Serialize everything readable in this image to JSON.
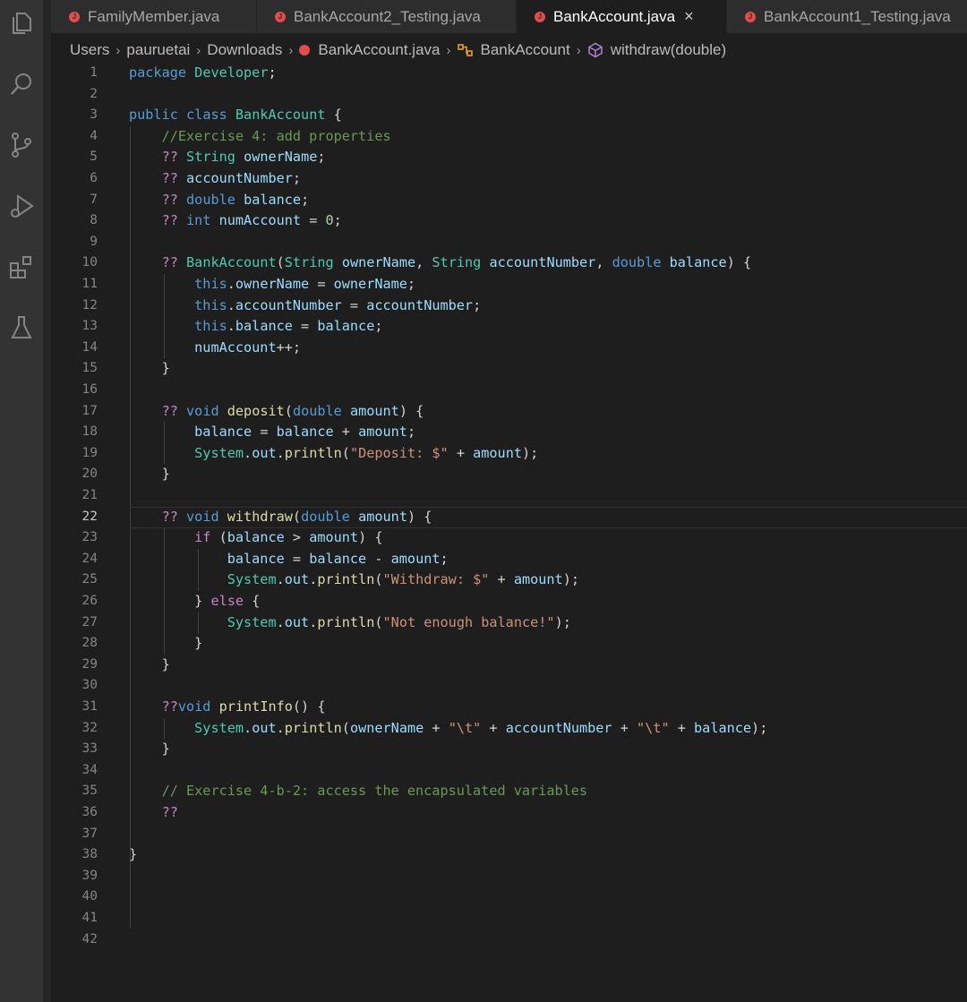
{
  "tabs": [
    {
      "label": "FamilyMember.java",
      "active": false
    },
    {
      "label": "BankAccount2_Testing.java",
      "active": false
    },
    {
      "label": "BankAccount.java",
      "active": true
    },
    {
      "label": "BankAccount1_Testing.java",
      "active": false
    }
  ],
  "tab_close_glyph": "×",
  "breadcrumb": {
    "items": [
      "Users",
      "pauruetai",
      "Downloads",
      "BankAccount.java",
      "BankAccount",
      "withdraw(double)"
    ],
    "separator": "›"
  },
  "activity_icons": [
    "explorer-icon",
    "search-icon",
    "source-control-icon",
    "run-debug-icon",
    "extensions-icon",
    "testing-icon"
  ],
  "editor": {
    "current_line": 22,
    "line_numbers": [
      "1",
      "2",
      "3",
      "4",
      "5",
      "6",
      "7",
      "8",
      "9",
      "10",
      "11",
      "12",
      "13",
      "14",
      "15",
      "16",
      "17",
      "18",
      "19",
      "20",
      "21",
      "22",
      "23",
      "24",
      "25",
      "26",
      "27",
      "28",
      "29",
      "30",
      "31",
      "32",
      "33",
      "34",
      "35",
      "36",
      "37",
      "38",
      "39",
      "40",
      "41",
      "42"
    ],
    "lines": [
      "package Developer;",
      "",
      "public class BankAccount {",
      "    //Exercise 4: add properties",
      "    ?? String ownerName;",
      "    ?? accountNumber;",
      "    ?? double balance;",
      "    ?? int numAccount = 0;",
      "",
      "    ?? BankAccount(String ownerName, String accountNumber, double balance) {",
      "        this.ownerName = ownerName;",
      "        this.accountNumber = accountNumber;",
      "        this.balance = balance;",
      "        numAccount++;",
      "    }",
      "",
      "    ?? void deposit(double amount) {",
      "        balance = balance + amount;",
      "        System.out.println(\"Deposit: $\" + amount);",
      "    }",
      "",
      "    ?? void withdraw(double amount) {",
      "        if (balance > amount) {",
      "            balance = balance - amount;",
      "            System.out.println(\"Withdraw: $\" + amount);",
      "        } else {",
      "            System.out.println(\"Not enough balance!\");",
      "        }",
      "    }",
      "",
      "    ??void printInfo() {",
      "        System.out.println(ownerName + \"\\t\" + accountNumber + \"\\t\" + balance);",
      "    }",
      "",
      "    // Exercise 4-b-2: access the encapsulated variables",
      "    ??",
      "",
      "}",
      "",
      "",
      "",
      ""
    ]
  },
  "colors": {
    "keyword": "#569cd6",
    "control": "#c586c0",
    "type": "#4ec9b0",
    "function": "#dcdcaa",
    "variable": "#9cdcfe",
    "string": "#ce9178",
    "comment": "#6a9955",
    "number": "#b5cea8",
    "error_squiggle": "#f14c4c",
    "java_badge": "#e34c4c"
  }
}
